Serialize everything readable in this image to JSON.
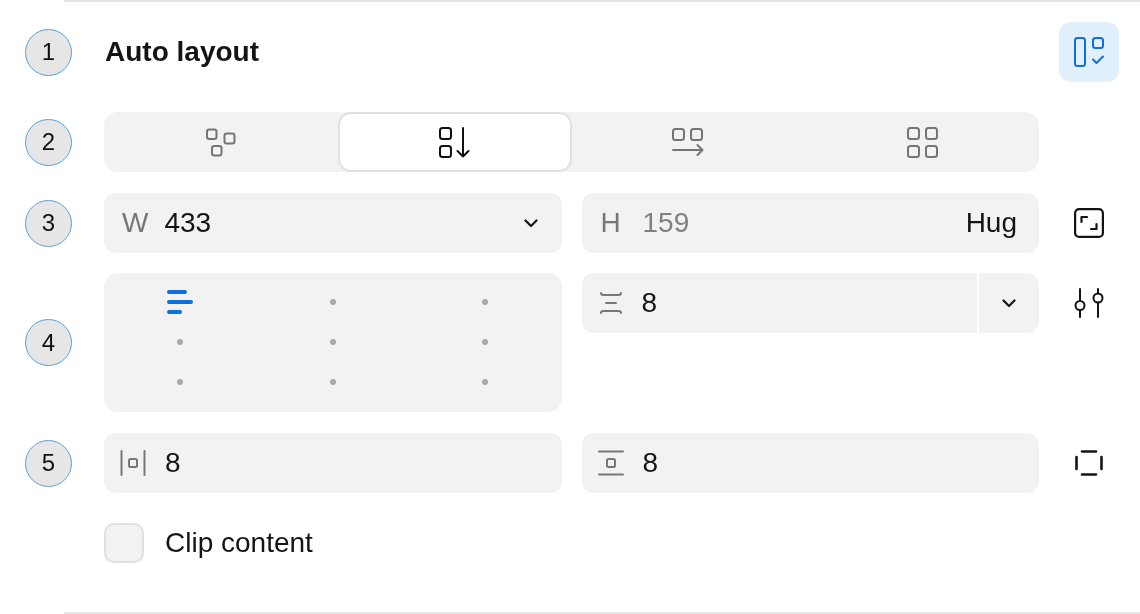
{
  "header": {
    "marker": "1",
    "title": "Auto layout",
    "toggle": {
      "on": true
    }
  },
  "direction": {
    "marker": "2",
    "options": [
      {
        "kind": "freeform",
        "selected": false
      },
      {
        "kind": "vertical",
        "selected": true
      },
      {
        "kind": "horizontal",
        "selected": false
      },
      {
        "kind": "grid",
        "selected": false
      }
    ]
  },
  "size": {
    "marker": "3",
    "width": {
      "label": "W",
      "value": "433"
    },
    "height": {
      "label": "H",
      "value": "159",
      "disabled": true,
      "mode": "Hug"
    }
  },
  "alignment": {
    "marker": "4",
    "positions": [
      {
        "selected": true
      },
      {
        "selected": false
      },
      {
        "selected": false
      },
      {
        "selected": false
      },
      {
        "selected": false
      },
      {
        "selected": false
      },
      {
        "selected": false
      },
      {
        "selected": false
      },
      {
        "selected": false
      }
    ],
    "gap": {
      "value": "8"
    }
  },
  "padding": {
    "marker": "5",
    "fields": [
      {
        "kind": "horizontal",
        "value": "8"
      },
      {
        "kind": "vertical",
        "value": "8"
      }
    ]
  },
  "clip_content": {
    "label": "Clip content",
    "checked": false
  }
}
